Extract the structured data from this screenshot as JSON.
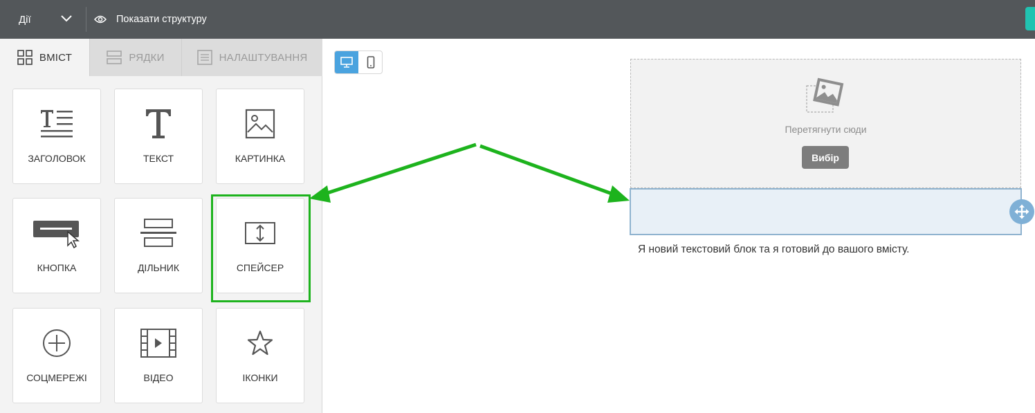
{
  "topbar": {
    "actions_label": "Дії",
    "preview_label": "Показати структуру"
  },
  "sidebar": {
    "tabs": [
      {
        "label": "ВМІСТ",
        "icon": "grid-icon",
        "active": true
      },
      {
        "label": "РЯДКИ",
        "icon": "rows-icon",
        "active": false
      },
      {
        "label": "НАЛАШТУВАННЯ",
        "icon": "settings-list-icon",
        "active": false
      }
    ],
    "tiles": [
      {
        "label": "ЗАГОЛОВОК",
        "icon": "heading-icon"
      },
      {
        "label": "ТЕКСТ",
        "icon": "text-icon"
      },
      {
        "label": "КАРТИНКА",
        "icon": "image-icon"
      },
      {
        "label": "КНОПКА",
        "icon": "button-icon"
      },
      {
        "label": "ДІЛЬНИК",
        "icon": "divider-icon"
      },
      {
        "label": "СПЕЙСЕР",
        "icon": "spacer-icon"
      },
      {
        "label": "СОЦМЕРЕЖІ",
        "icon": "social-icon"
      },
      {
        "label": "ВІДЕО",
        "icon": "video-icon"
      },
      {
        "label": "ІКОНКИ",
        "icon": "star-icon"
      }
    ]
  },
  "canvas": {
    "device_modes": [
      "desktop",
      "mobile"
    ],
    "active_device": "desktop",
    "image_drop": {
      "drop_label": "Перетягнути сюди",
      "browse_label": "Вибір"
    },
    "text_block": "Я новий текстовий блок та я готовий до вашого вмісту."
  },
  "colors": {
    "topbar": "#53575a",
    "highlight": "#1db31d",
    "accent": "#4aa3df",
    "spacer_fill": "#e8f0f7"
  }
}
